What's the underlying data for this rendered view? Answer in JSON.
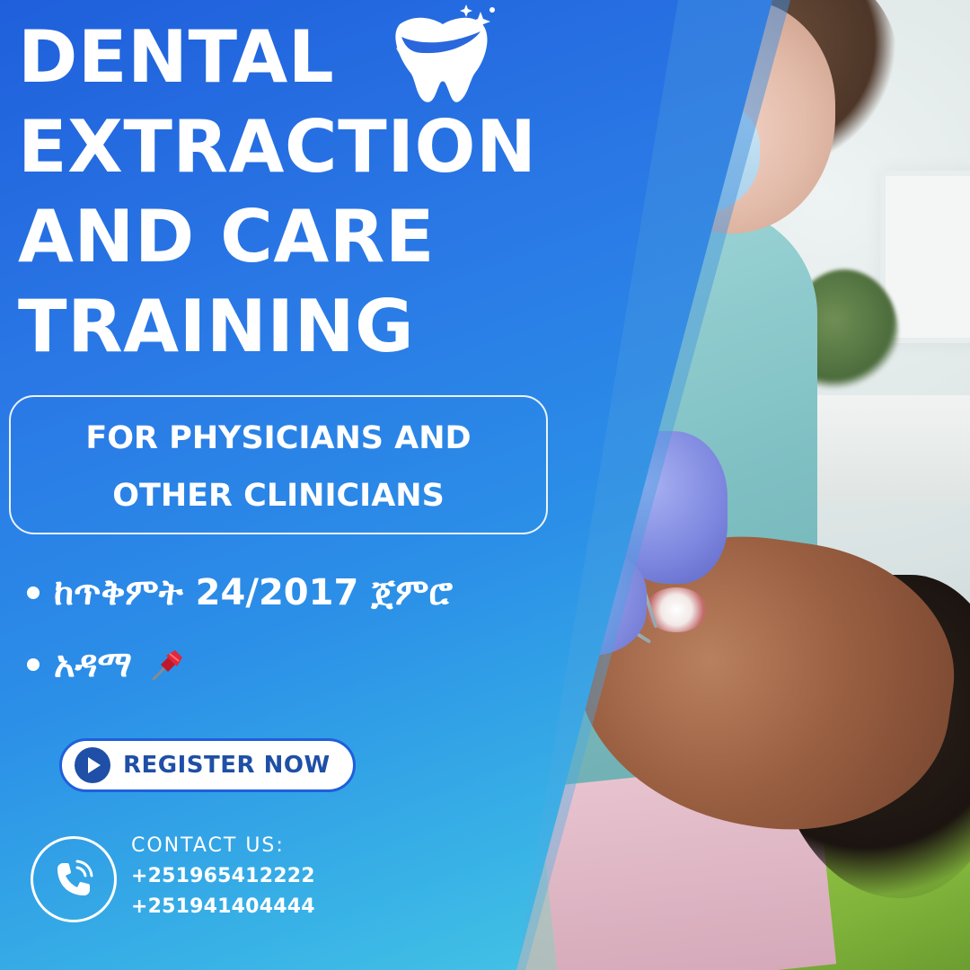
{
  "poster": {
    "title_lines": [
      "DENTAL",
      "EXTRACTION",
      "AND CARE",
      "TRAINING"
    ],
    "subtitle_lines": [
      "FOR PHYSICIANS AND",
      "OTHER CLINICIANS"
    ],
    "bullets": [
      {
        "text": "ከጥቅምት 24/2017 ጀምሮ"
      },
      {
        "text": "አዳማ"
      }
    ],
    "register_button": {
      "label": "REGISTER NOW"
    },
    "contact": {
      "label": "CONTACT US:",
      "phones": [
        "+251965412222",
        "+251941404444"
      ]
    },
    "colors": {
      "blue_dark": "#1f5fdb",
      "blue_mid": "#2b8fe7",
      "cyan_light": "#4fd2e3",
      "button_text": "#1f4fa6",
      "white": "#ffffff"
    },
    "icons": {
      "tooth": "tooth-icon",
      "play": "play-icon",
      "phone": "phone-icon",
      "pin": "pushpin-icon"
    }
  }
}
